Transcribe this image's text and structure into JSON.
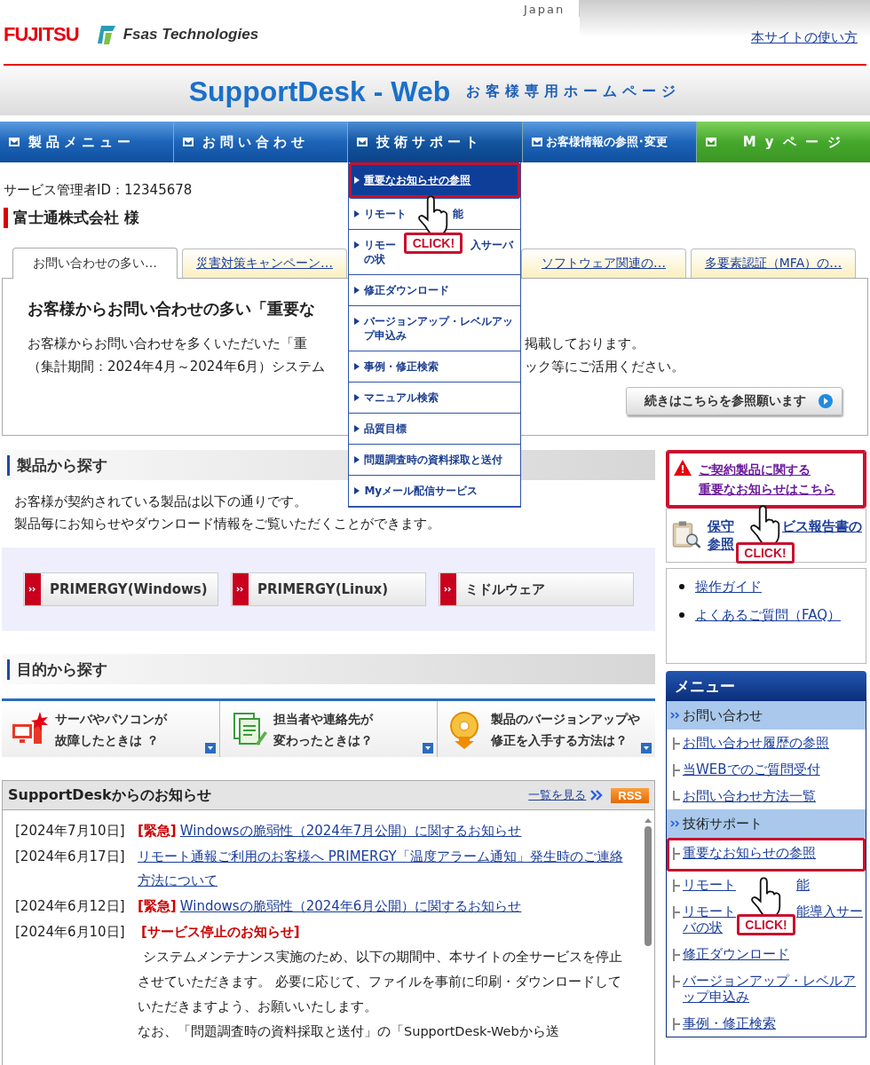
{
  "header": {
    "logo": "FUJITSU",
    "brand": "Fsas Technologies",
    "region": "Japan",
    "help_link": "本サイトの使い方"
  },
  "banner": {
    "title": "SupportDesk - Web",
    "subtitle": "お客様専用ホームページ"
  },
  "nav": [
    {
      "label": "製品メニュー",
      "kind": "blue"
    },
    {
      "label": "お問い合わせ",
      "kind": "blue"
    },
    {
      "label": "技術サポート",
      "kind": "blue",
      "expanded": true
    },
    {
      "label": "お客様情報の参照･変更",
      "kind": "blue"
    },
    {
      "label": "Myページ",
      "kind": "green"
    }
  ],
  "dropdown": [
    {
      "label": "重要なお知らせの参照",
      "selected": true,
      "callout": "CLICK!"
    },
    {
      "label": [
        [
          "リモート",
          "能"
        ]
      ],
      "selected": false
    },
    {
      "label": [
        [
          "リモー",
          "入サーバ"
        ],
        [
          "の状"
        ]
      ],
      "selected": false
    },
    {
      "label": "修正ダウンロード",
      "selected": false
    },
    {
      "label": "バージョンアップ・レベルアップ申込み",
      "selected": false
    },
    {
      "label": "事例・修正検索",
      "selected": false
    },
    {
      "label": "マニュアル検索",
      "selected": false
    },
    {
      "label": "品質目標",
      "selected": false
    },
    {
      "label": "問題調査時の資料採取と送付",
      "selected": false
    },
    {
      "label": "Myメール配信サービス",
      "selected": false
    }
  ],
  "account": {
    "id_line": "サービス管理者ID：12345678",
    "company": "富士通株式会社 様"
  },
  "tabs": [
    {
      "label": "お問い合わせの多い…",
      "selected": true
    },
    {
      "label": "災害対策キャンペーン…",
      "selected": false
    },
    {
      "label": "ソフトウェア関連の…",
      "selected": false
    },
    {
      "label": "多要素認証（MFA）の…",
      "selected": false
    }
  ],
  "tab_panel": {
    "title": "お客様からお問い合わせの多い「重要な",
    "lines": [
      {
        "left": "お客様からお問い合わせを多くいただいた「重",
        "right": "掲載しております。"
      },
      {
        "left": "（集計期間：2024年4月～2024年6月）システム",
        "right": "ック等にご活用ください。"
      }
    ],
    "button": "続きはこちらを参照願います"
  },
  "products": {
    "title": "製品から探す",
    "lines": [
      "お客様が契約されている製品は以下の通りです。",
      "製品毎にお知らせやダウンロード情報をご覧いただくことができます。"
    ],
    "buttons": [
      "PRIMERGY(Windows)",
      "PRIMERGY(Linux)",
      "ミドルウェア"
    ]
  },
  "purposes": {
    "title": "目的から探す",
    "cards": [
      {
        "kind": "broken",
        "lines": [
          "サーバやパソコンが",
          "故障したときは ？"
        ]
      },
      {
        "kind": "contact",
        "lines": [
          "担当者や連絡先が",
          "変わったときは？"
        ]
      },
      {
        "kind": "version",
        "lines": [
          "製品のバージョンアップや",
          "修正を入手する方法は？"
        ]
      }
    ]
  },
  "news": {
    "title": "SupportDeskからのお知らせ",
    "list_link": "一覧を見る",
    "rss": "RSS",
    "items": [
      {
        "date": "[2024年7月10日]",
        "tag": "[緊急]",
        "link": "Windowsの脆弱性（2024年7月公開）に関するお知らせ"
      },
      {
        "date": "[2024年6月17日]",
        "link": "リモート通報ご利用のお客様へ PRIMERGY「温度アラーム通知」発生時のご連絡方法について"
      },
      {
        "date": "[2024年6月12日]",
        "tag": "[緊急]",
        "link": "Windowsの脆弱性（2024年6月公開）に関するお知らせ"
      },
      {
        "date": "[2024年6月10日]",
        "tag": "[サービス停止のお知らせ]",
        "body": [
          "システムメンテナンス実施のため、以下の期間中、本サイトの全サービスを停止させていただきます。 必要に応じて、ファイルを事前に印刷・ダウンロードしていただきますよう、お願いいたします。",
          "なお、「問題調査時の資料採取と送付」の「SupportDesk-Webから送"
        ]
      }
    ]
  },
  "sidebar": {
    "notice": {
      "lines": [
        "ご契約製品に関する",
        "重要なお知らせはこちら"
      ],
      "callout": "CLICK!"
    },
    "report": [
      [
        "保守",
        "ビス報告書の"
      ],
      [
        "参照"
      ]
    ],
    "links": [
      "操作ガイド",
      "よくあるご質問（FAQ）"
    ],
    "menu": {
      "title": "メニュー",
      "items": [
        {
          "kind": "section",
          "label": "お問い合わせ"
        },
        {
          "kind": "link",
          "label": "お問い合わせ履歴の参照"
        },
        {
          "kind": "link",
          "label": "当WEBでのご質問受付"
        },
        {
          "kind": "last",
          "label": "お問い合わせ方法一覧"
        },
        {
          "kind": "section",
          "label": "技術サポート"
        },
        {
          "kind": "link",
          "label": "重要なお知らせの参照",
          "callout": "CLICK!"
        },
        {
          "kind": "link",
          "label": [
            [
              "リモート",
              "能"
            ]
          ]
        },
        {
          "kind": "link",
          "label": [
            [
              "リモート",
              "能導入サー"
            ],
            [
              "バの状"
            ]
          ]
        },
        {
          "kind": "link",
          "label": "修正ダウンロード"
        },
        {
          "kind": "link",
          "label": "バージョンアップ・レベルアップ申込み"
        },
        {
          "kind": "link",
          "label": "事例・修正検索"
        }
      ]
    }
  }
}
